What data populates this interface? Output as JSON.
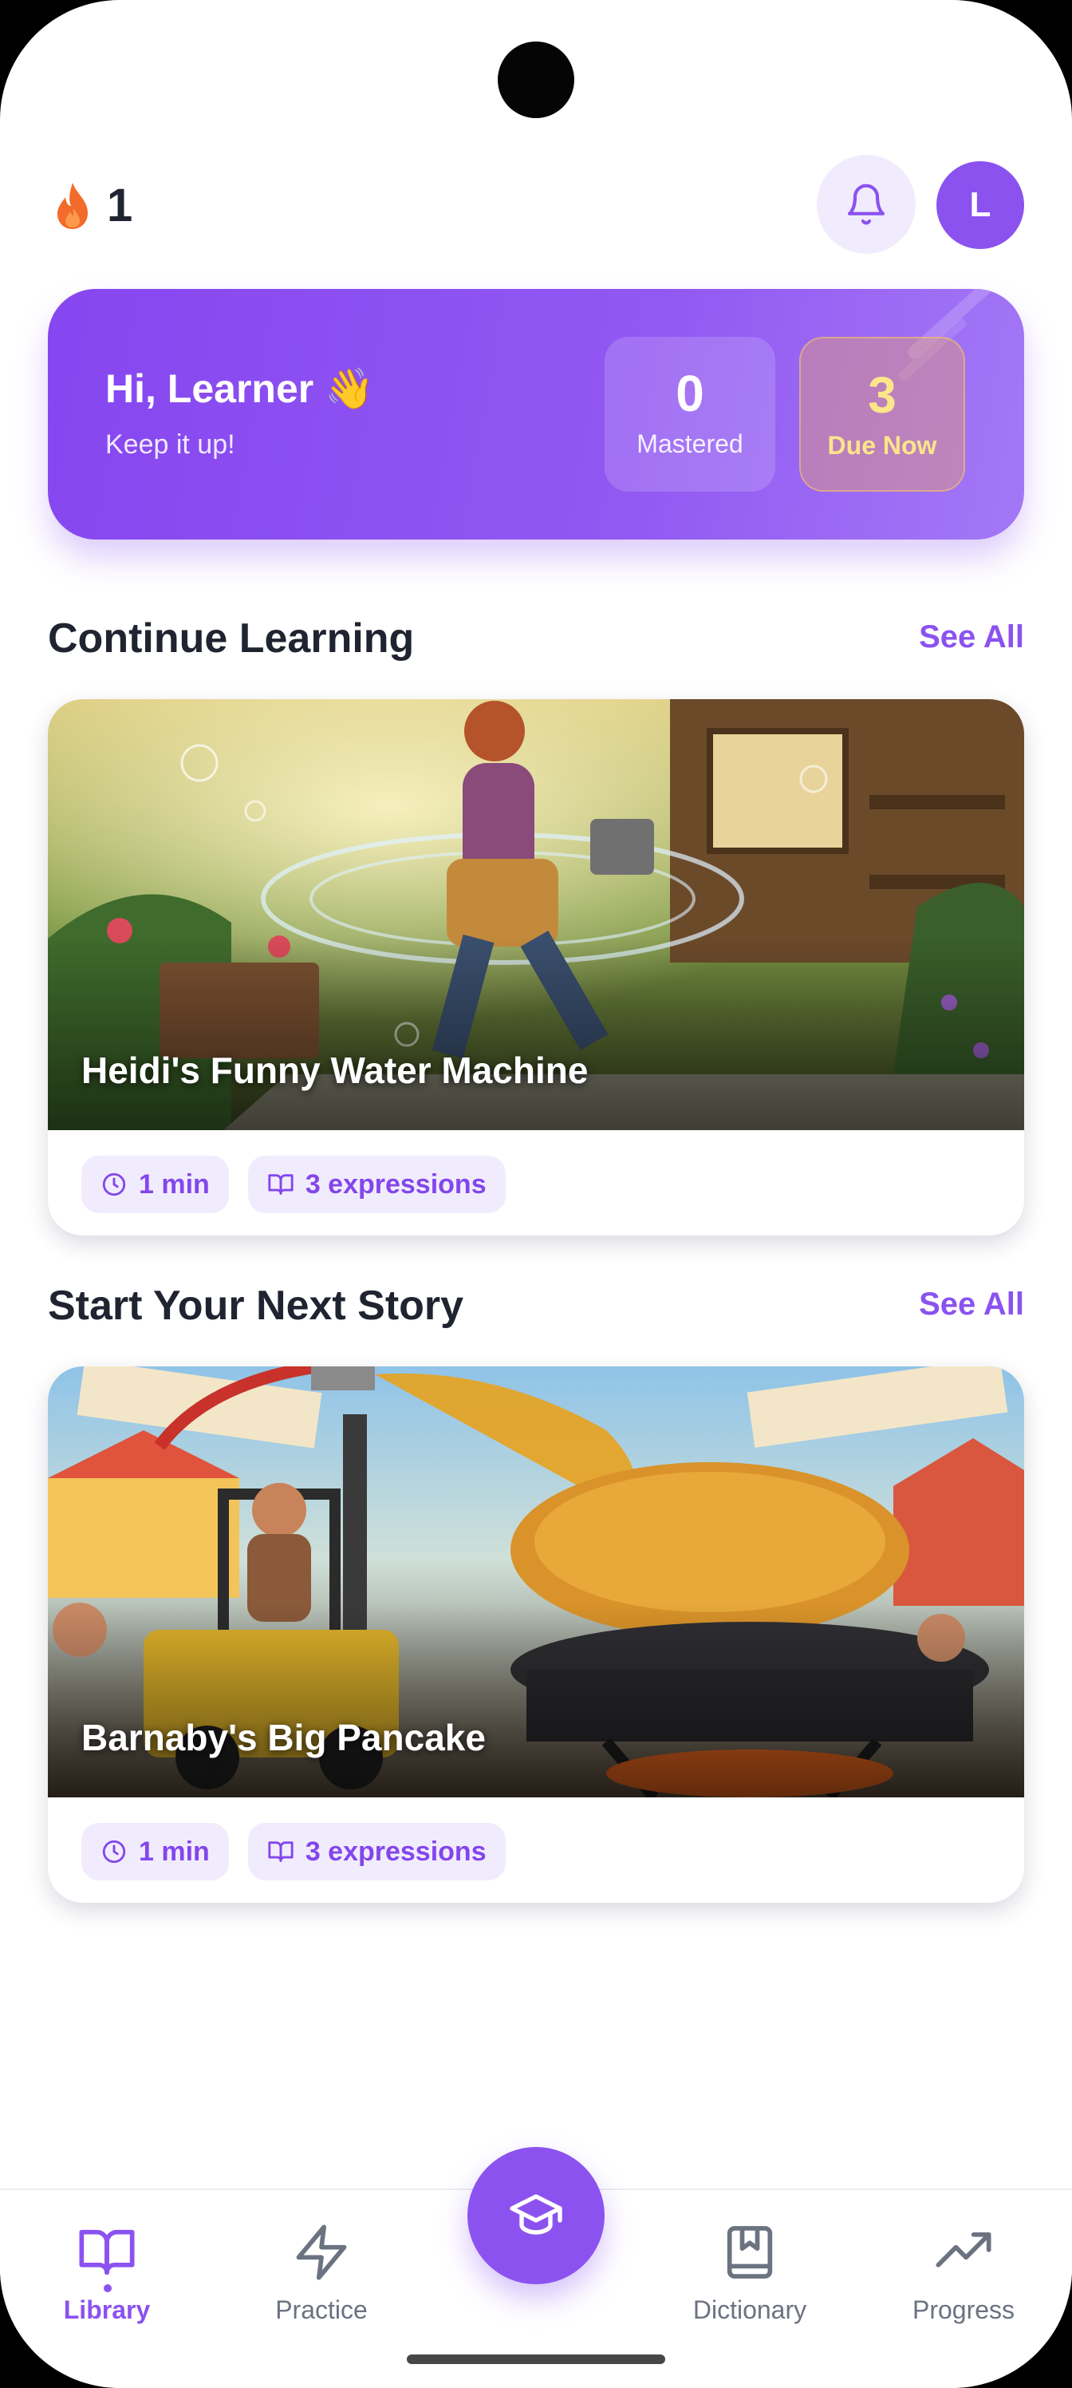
{
  "header": {
    "streak_count": "1",
    "avatar_initial": "L"
  },
  "hero": {
    "greeting": "Hi, Learner 👋",
    "subtitle": "Keep it up!",
    "mastered_value": "0",
    "mastered_label": "Mastered",
    "due_value": "3",
    "due_label": "Due Now"
  },
  "sections": {
    "continue_title": "Continue Learning",
    "continue_see_all": "See All",
    "next_title": "Start Your Next Story",
    "next_see_all": "See All"
  },
  "stories": [
    {
      "title": "Heidi's Funny Water Machine",
      "duration": "1 min",
      "expressions": "3 expressions"
    },
    {
      "title": "Barnaby's Big Pancake",
      "duration": "1 min",
      "expressions": "3 expressions"
    }
  ],
  "nav": {
    "items": [
      {
        "label": "Library",
        "icon": "book-open-icon",
        "active": true
      },
      {
        "label": "Practice",
        "icon": "lightning-icon",
        "active": false
      },
      {
        "label": "Dictionary",
        "icon": "bookmark-book-icon",
        "active": false
      },
      {
        "label": "Progress",
        "icon": "trending-up-icon",
        "active": false
      }
    ],
    "center_icon": "graduation-cap-icon"
  },
  "colors": {
    "accent": "#8b52f0",
    "due_text": "#fde58a",
    "streak_flame": "#f26b2a",
    "text_dark": "#1f2430"
  }
}
